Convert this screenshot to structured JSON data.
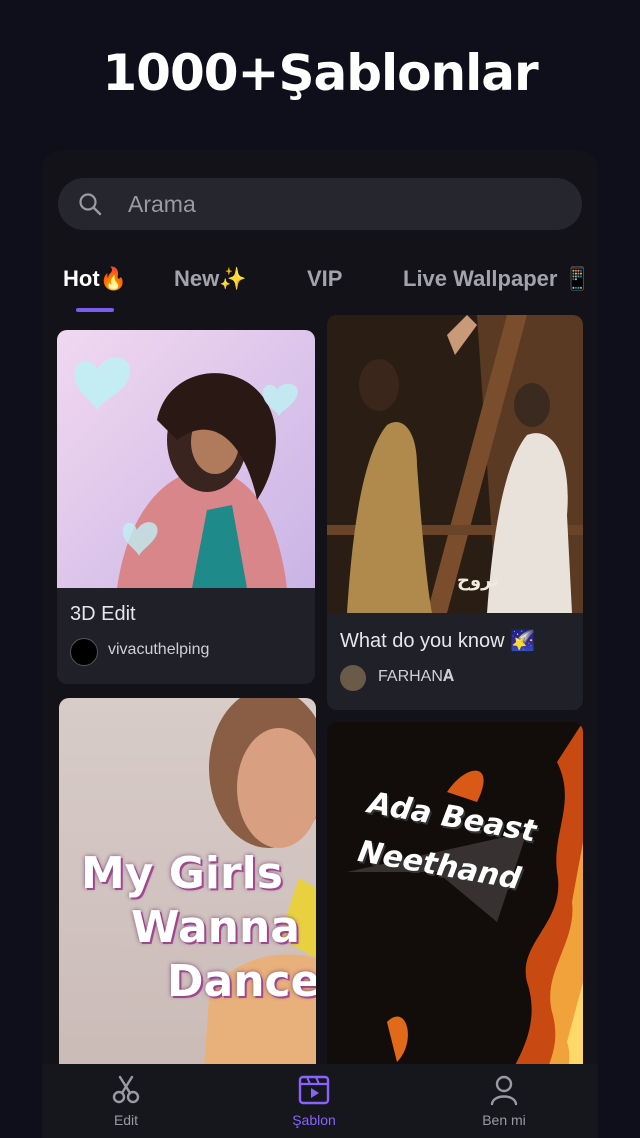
{
  "headline": "1000+Şablonlar",
  "search": {
    "placeholder": "Arama"
  },
  "tabs": [
    {
      "label": "Hot🔥",
      "active": true
    },
    {
      "label": "New✨",
      "active": false
    },
    {
      "label": "VIP",
      "active": false
    },
    {
      "label": "Live Wallpaper 📱",
      "active": false
    }
  ],
  "templates": [
    {
      "title": "3D Edit",
      "author": "vivacuthelping",
      "icon": "hearts-dance-thumbnail"
    },
    {
      "title": "What do you know 🌠",
      "author": "FARHAN𝐀",
      "icon": "couple-bridge-thumbnail",
      "overlay": "تروح"
    },
    {
      "overlay_lines": [
        "My Girls",
        "Wanna",
        "Dance"
      ],
      "icon": "girls-dance-thumbnail"
    },
    {
      "overlay_lines": [
        "Ada Beast",
        "Neethand"
      ],
      "icon": "fire-beast-thumbnail"
    }
  ],
  "nav": [
    {
      "label": "Edit",
      "icon": "scissors-icon",
      "active": false
    },
    {
      "label": "Şablon",
      "icon": "template-icon",
      "active": true
    },
    {
      "label": "Ben mi",
      "icon": "profile-icon",
      "active": false
    }
  ],
  "colors": {
    "accent": "#7b5cf0",
    "background": "#0f0f1c",
    "card": "#202028"
  }
}
